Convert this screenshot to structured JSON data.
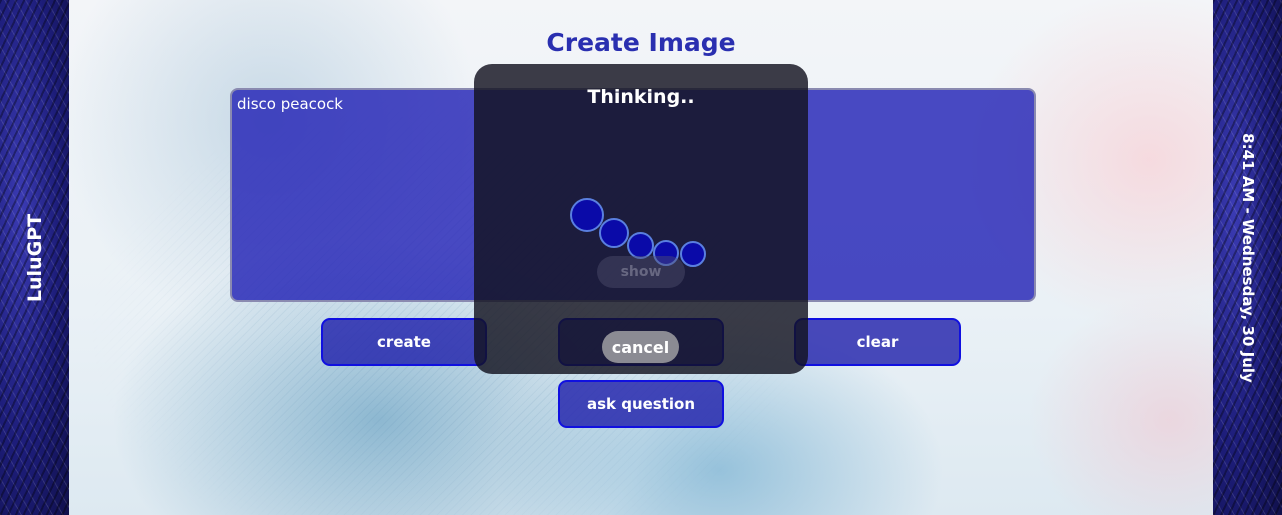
{
  "sidebar_left": {
    "brand": "LuluGPT"
  },
  "sidebar_right": {
    "datetime": "8:41 AM - Wednesday, 30 July"
  },
  "page": {
    "title": "Create Image"
  },
  "prompt": {
    "value": "disco peacock"
  },
  "buttons": {
    "create": "create",
    "clear": "clear",
    "ask_question": "ask question"
  },
  "modal": {
    "title": "Thinking..",
    "show_label": "show",
    "cancel_label": "cancel"
  },
  "colors": {
    "title": "#2a2fb0",
    "panel": "#1e1eb4",
    "button_border": "#1010e0",
    "modal_bg": "#121220"
  }
}
